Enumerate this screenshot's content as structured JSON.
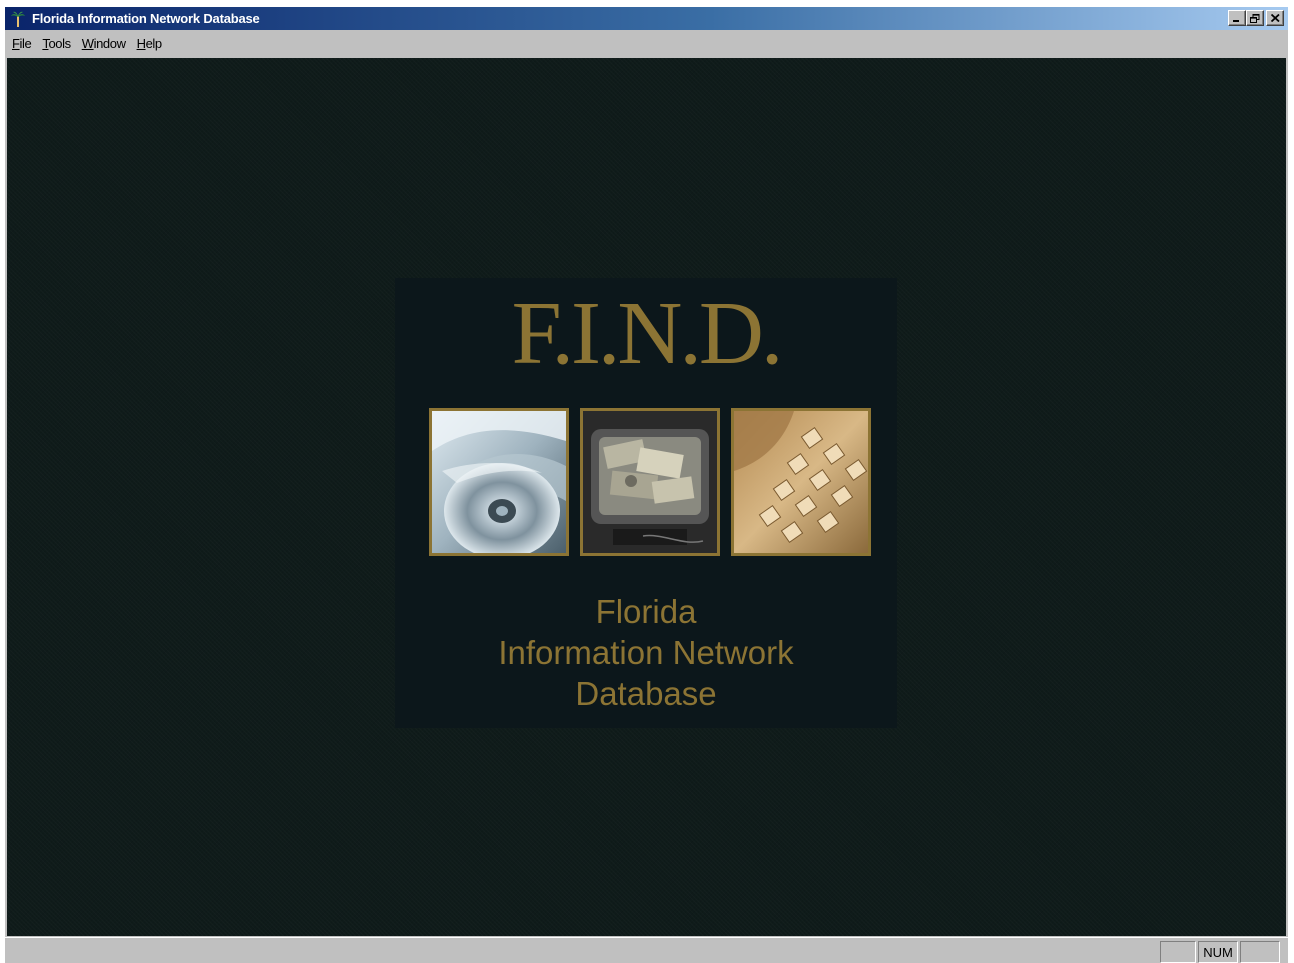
{
  "window": {
    "title": "Florida Information Network Database",
    "controls": {
      "minimize": "_",
      "maximize": "▫",
      "close": "✕"
    }
  },
  "menu": {
    "items": [
      {
        "underline": "F",
        "rest": "ile"
      },
      {
        "underline": "T",
        "rest": "ools"
      },
      {
        "underline": "W",
        "rest": "indow"
      },
      {
        "underline": "H",
        "rest": "elp"
      }
    ]
  },
  "splash": {
    "logo": "F.I.N.D.",
    "subtitle_line1": "Florida",
    "subtitle_line2": "Information Network",
    "subtitle_line3": "Database",
    "images": [
      "cd-disc-photo",
      "monitor-money-photo",
      "keyboard-photo"
    ],
    "accent_color": "#8c7434"
  },
  "statusbar": {
    "caps": "",
    "num": "NUM",
    "scrl": ""
  }
}
